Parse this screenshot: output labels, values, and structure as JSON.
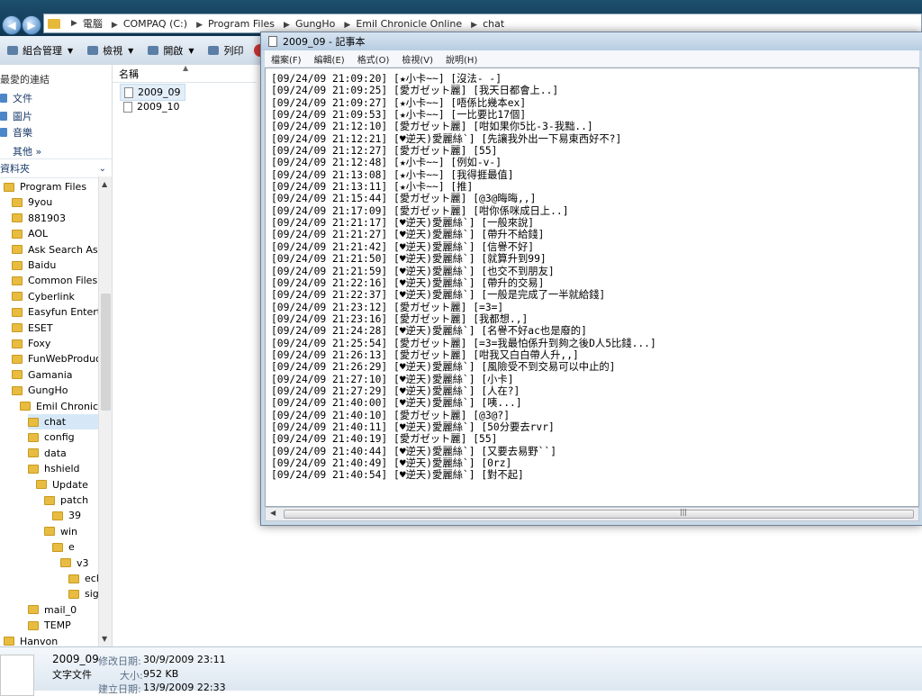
{
  "address": {
    "crumbs": [
      "電腦",
      "COMPAQ (C:)",
      "Program Files",
      "GungHo",
      "Emil Chronicle Online",
      "chat"
    ]
  },
  "toolbar": {
    "organize_label": "組合管理",
    "views_label": "檢視",
    "open_label": "開啟",
    "print_label": "列印"
  },
  "nav": {
    "favorites_title": "最愛的連結",
    "favorites": [
      "文件",
      "圖片",
      "音樂"
    ],
    "more_label": "其他 »",
    "folders_title": "資料夾",
    "tree": [
      {
        "label": "Program Files",
        "indent": 0
      },
      {
        "label": "9you",
        "indent": 1
      },
      {
        "label": "881903",
        "indent": 1
      },
      {
        "label": "AOL",
        "indent": 1
      },
      {
        "label": "Ask Search Assistant",
        "indent": 1
      },
      {
        "label": "Baidu",
        "indent": 1
      },
      {
        "label": "Common Files",
        "indent": 1
      },
      {
        "label": "Cyberlink",
        "indent": 1
      },
      {
        "label": "Easyfun Entertainment",
        "indent": 1
      },
      {
        "label": "ESET",
        "indent": 1
      },
      {
        "label": "Foxy",
        "indent": 1
      },
      {
        "label": "FunWebProducts",
        "indent": 1
      },
      {
        "label": "Gamania",
        "indent": 1
      },
      {
        "label": "GungHo",
        "indent": 1
      },
      {
        "label": "Emil Chronicle Online",
        "indent": 2
      },
      {
        "label": "chat",
        "indent": 3,
        "selected": true
      },
      {
        "label": "config",
        "indent": 3
      },
      {
        "label": "data",
        "indent": 3
      },
      {
        "label": "hshield",
        "indent": 3
      },
      {
        "label": "Update",
        "indent": 4
      },
      {
        "label": "patch",
        "indent": 5
      },
      {
        "label": "39",
        "indent": 6
      },
      {
        "label": "win",
        "indent": 5
      },
      {
        "label": "e",
        "indent": 6
      },
      {
        "label": "v3",
        "indent": 7
      },
      {
        "label": "echo",
        "indent": 8
      },
      {
        "label": "sign_",
        "indent": 8
      },
      {
        "label": "mail_0",
        "indent": 3
      },
      {
        "label": "TEMP",
        "indent": 3
      },
      {
        "label": "Hanvon",
        "indent": 0
      }
    ]
  },
  "files": {
    "column_name": "名稱",
    "items": [
      "2009_09",
      "2009_10"
    ]
  },
  "details": {
    "name": "2009_09",
    "type": "文字文件",
    "modified_label": "修改日期:",
    "modified_value": "30/9/2009 23:11",
    "size_label": "大小:",
    "size_value": "952 KB",
    "created_label": "建立日期:",
    "created_value": "13/9/2009 22:33"
  },
  "notepad": {
    "title": "2009_09 - 記事本",
    "menu": [
      "檔案(F)",
      "編輯(E)",
      "格式(O)",
      "檢視(V)",
      "說明(H)"
    ],
    "lines": [
      "[09/24/09 21:09:20] [★小卡~~] [沒法- -]",
      "[09/24/09 21:09:25] [愛ガゼット麗] [我天日都會上..]",
      "[09/24/09 21:09:27] [★小卡~~] [唔係比幾本ex]",
      "[09/24/09 21:09:53] [★小卡~~] [一比要比17個]",
      "[09/24/09 21:12:10] [愛ガゼット麗] [咁如果你5比-3-我黜..]",
      "[09/24/09 21:12:21] [♥逆天)愛麗絲`] [先讓我外出一下易東西好不?]",
      "[09/24/09 21:12:27] [愛ガゼット麗] [55]",
      "[09/24/09 21:12:48] [★小卡~~] [例如-v-]",
      "[09/24/09 21:13:08] [★小卡~~] [我得捱最值]",
      "[09/24/09 21:13:11] [★小卡~~] [推]",
      "[09/24/09 21:15:44] [愛ガゼット麗] [@3@晦晦,,]",
      "[09/24/09 21:17:09] [愛ガゼット麗] [咁你係咪成日上..]",
      "[09/24/09 21:21:17] [♥逆天)愛麗絲`] [一般來說]",
      "[09/24/09 21:21:27] [♥逆天)愛麗絲`] [帶升不給錢]",
      "[09/24/09 21:21:42] [♥逆天)愛麗絲`] [信譽不好]",
      "[09/24/09 21:21:50] [♥逆天)愛麗絲`] [就算升到99]",
      "[09/24/09 21:21:59] [♥逆天)愛麗絲`] [也交不到朋友]",
      "[09/24/09 21:22:16] [♥逆天)愛麗絲`] [帶升的交易]",
      "[09/24/09 21:22:37] [♥逆天)愛麗絲`] [一般是完成了一半就給錢]",
      "[09/24/09 21:23:12] [愛ガゼット麗] [=3=]",
      "[09/24/09 21:23:16] [愛ガゼット麗] [我都想.,]",
      "[09/24/09 21:24:28] [♥逆天)愛麗絲`] [名譽不好ac也是廢的]",
      "[09/24/09 21:25:54] [愛ガゼット麗] [=3=我最怕係升到夠之後D人5比錢...]",
      "[09/24/09 21:26:13] [愛ガゼット麗] [咁我又白白帶人升,,]",
      "[09/24/09 21:26:29] [♥逆天)愛麗絲`] [風險受不到交易可以中止的]",
      "[09/24/09 21:27:10] [♥逆天)愛麗絲`] [小卡]",
      "[09/24/09 21:27:29] [♥逆天)愛麗絲`] [人在?]",
      "[09/24/09 21:40:00] [♥逆天)愛麗絲`] [咦...]",
      "[09/24/09 21:40:10] [愛ガゼット麗] [@3@?]",
      "[09/24/09 21:40:11] [♥逆天)愛麗絲`] [50分要去rvr]",
      "[09/24/09 21:40:19] [愛ガゼット麗] [55]",
      "[09/24/09 21:40:44] [♥逆天)愛麗絲`] [又要去易野``]",
      "[09/24/09 21:40:49] [♥逆天)愛麗絲`] [0rz]",
      "[09/24/09 21:40:54] [♥逆天)愛麗絲`] [對不起]"
    ]
  },
  "colors": {
    "accent": "#1d4f6e",
    "folder": "#e8bc40",
    "selection": "#d6e8f7"
  }
}
